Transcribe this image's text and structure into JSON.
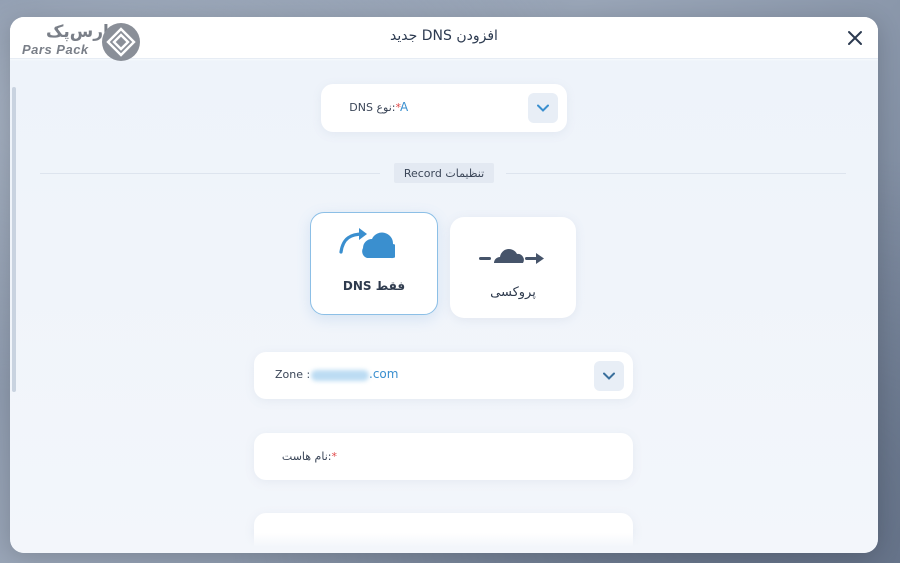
{
  "dialog": {
    "title": "افزودن DNS جدید",
    "close_icon": "close-icon"
  },
  "logo": {
    "text_fa": "پارس‌پک",
    "text_en": "Pars Pack"
  },
  "dns_type": {
    "label": ":نوع DNS",
    "required_mark": "*",
    "value": "A"
  },
  "record_settings": {
    "label": "تنظیمات Record"
  },
  "modes": [
    {
      "label": "فقط DNS",
      "icon": "cloud-redirect-icon",
      "selected": true
    },
    {
      "label": "پروکسی",
      "icon": "cloud-proxy-icon",
      "selected": false
    }
  ],
  "zone": {
    "label": "Zone :",
    "value_suffix": ".com"
  },
  "hostname": {
    "label": ":نام هاست",
    "required_mark": "*"
  },
  "colors": {
    "accent": "#3a8fcf",
    "required": "#e04848",
    "text": "#2f3b4e"
  }
}
